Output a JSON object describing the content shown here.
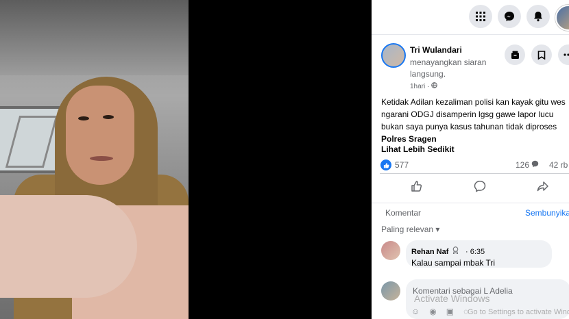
{
  "topbar": {
    "icons": [
      "menu-grid-icon",
      "messenger-icon",
      "bell-icon",
      "profile-avatar"
    ]
  },
  "post": {
    "author": "Tri Wulandari",
    "action": "menayangkan siaran langsung.",
    "time": "1hari ·",
    "caption_plain": "Ketidak Adilan kezaliman polisi kan kayak gitu wes ngarani ODGJ disamperin lgsg gawe lapor lucu bukan saya punya kasus tahunan tidak diproses ",
    "caption_bold": "Polres Sragen",
    "see_less": "Lihat Lebih Sedikit",
    "likes": "577",
    "comments": "126",
    "shares": "42 rb"
  },
  "comments_section": {
    "tab_label": "Komentar",
    "hide_label": "Sembunyikan",
    "sort_label": "Paling relevan ▾",
    "comments": [
      {
        "name": "Rehan Naf",
        "time": "· 6:35",
        "text": "Kalau sampai mbak Tri"
      }
    ],
    "input_placeholder": "Komentari sebagai L Adelia"
  },
  "watermark": {
    "title": "Activate Windows",
    "subtitle": "Go to Settings to activate Windows."
  }
}
